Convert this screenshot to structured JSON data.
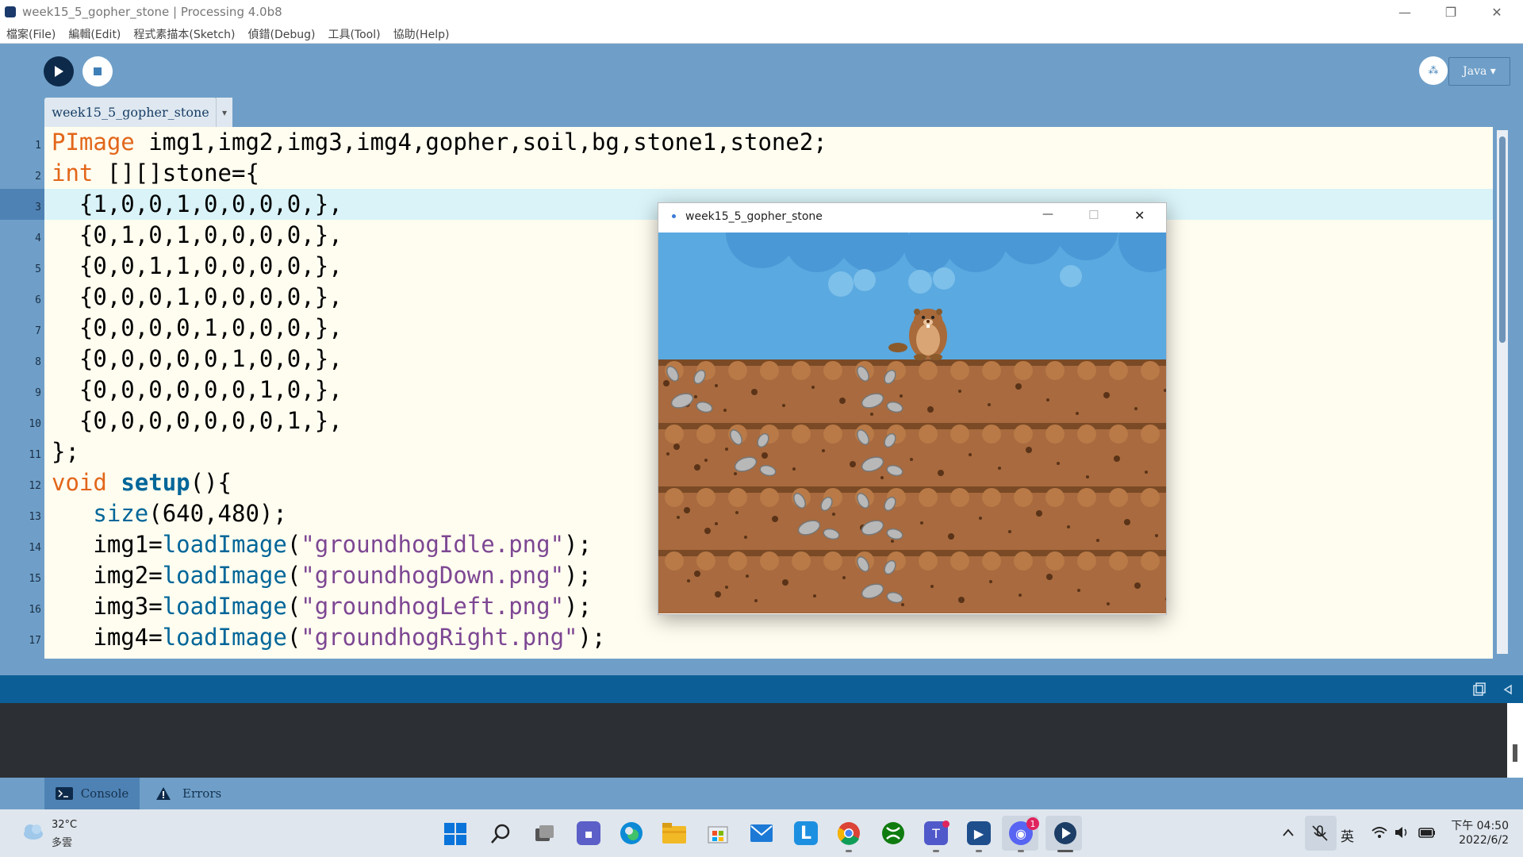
{
  "window": {
    "title": "week15_5_gopher_stone | Processing 4.0b8",
    "min": "—",
    "max": "❐",
    "close": "✕"
  },
  "menu": [
    "檔案(File)",
    "編輯(Edit)",
    "程式素描本(Sketch)",
    "偵錯(Debug)",
    "工具(Tool)",
    "協助(Help)"
  ],
  "toolbar": {
    "mode_icon": "⁂",
    "mode_label": "Java ▾"
  },
  "tab": {
    "label": "week15_5_gopher_stone",
    "arrow": "▾"
  },
  "code_lines": [
    {
      "n": "1",
      "parts": [
        {
          "t": "PImage",
          "c": "kw"
        },
        {
          "t": " img1,img2,img3,img4,gopher,soil,bg,stone1,stone2;",
          "c": ""
        }
      ]
    },
    {
      "n": "2",
      "parts": [
        {
          "t": "int",
          "c": "kw"
        },
        {
          "t": " [][]stone={",
          "c": ""
        }
      ]
    },
    {
      "n": "3",
      "parts": [
        {
          "t": "  {1,0,0,1,0,0,0,0,},",
          "c": ""
        }
      ]
    },
    {
      "n": "4",
      "parts": [
        {
          "t": "  {0,1,0,1,0,0,0,0,},",
          "c": ""
        }
      ]
    },
    {
      "n": "5",
      "parts": [
        {
          "t": "  {0,0,1,1,0,0,0,0,},",
          "c": ""
        }
      ]
    },
    {
      "n": "6",
      "parts": [
        {
          "t": "  {0,0,0,1,0,0,0,0,},",
          "c": ""
        }
      ]
    },
    {
      "n": "7",
      "parts": [
        {
          "t": "  {0,0,0,0,1,0,0,0,},",
          "c": ""
        }
      ]
    },
    {
      "n": "8",
      "parts": [
        {
          "t": "  {0,0,0,0,0,1,0,0,},",
          "c": ""
        }
      ]
    },
    {
      "n": "9",
      "parts": [
        {
          "t": "  {0,0,0,0,0,0,1,0,},",
          "c": ""
        }
      ]
    },
    {
      "n": "10",
      "parts": [
        {
          "t": "  {0,0,0,0,0,0,0,1,},",
          "c": ""
        }
      ]
    },
    {
      "n": "11",
      "parts": [
        {
          "t": "};",
          "c": ""
        }
      ]
    },
    {
      "n": "12",
      "parts": [
        {
          "t": "void",
          "c": "kw"
        },
        {
          "t": " ",
          "c": ""
        },
        {
          "t": "setup",
          "c": "fnb"
        },
        {
          "t": "(){",
          "c": ""
        }
      ]
    },
    {
      "n": "13",
      "parts": [
        {
          "t": "   ",
          "c": ""
        },
        {
          "t": "size",
          "c": "fn"
        },
        {
          "t": "(640,480);",
          "c": ""
        }
      ]
    },
    {
      "n": "14",
      "parts": [
        {
          "t": "   img1=",
          "c": ""
        },
        {
          "t": "loadImage",
          "c": "fn"
        },
        {
          "t": "(",
          "c": ""
        },
        {
          "t": "\"groundhogIdle.png\"",
          "c": "str"
        },
        {
          "t": ");",
          "c": ""
        }
      ]
    },
    {
      "n": "15",
      "parts": [
        {
          "t": "   img2=",
          "c": ""
        },
        {
          "t": "loadImage",
          "c": "fn"
        },
        {
          "t": "(",
          "c": ""
        },
        {
          "t": "\"groundhogDown.png\"",
          "c": "str"
        },
        {
          "t": ");",
          "c": ""
        }
      ]
    },
    {
      "n": "16",
      "parts": [
        {
          "t": "   img3=",
          "c": ""
        },
        {
          "t": "loadImage",
          "c": "fn"
        },
        {
          "t": "(",
          "c": ""
        },
        {
          "t": "\"groundhogLeft.png\"",
          "c": "str"
        },
        {
          "t": ");",
          "c": ""
        }
      ]
    },
    {
      "n": "17",
      "parts": [
        {
          "t": "   img4=",
          "c": ""
        },
        {
          "t": "loadImage",
          "c": "fn"
        },
        {
          "t": "(",
          "c": ""
        },
        {
          "t": "\"groundhogRight.png\"",
          "c": "str"
        },
        {
          "t": ");",
          "c": ""
        }
      ]
    }
  ],
  "sketch_window": {
    "title": "week15_5_gopher_stone",
    "min": "—",
    "max": "☐",
    "close": "✕"
  },
  "stone_grid": [
    [
      1,
      0,
      0,
      1,
      0,
      0,
      0,
      0
    ],
    [
      0,
      1,
      0,
      1,
      0,
      0,
      0,
      0
    ],
    [
      0,
      0,
      1,
      1,
      0,
      0,
      0,
      0
    ],
    [
      0,
      0,
      0,
      1,
      0,
      0,
      0,
      0
    ]
  ],
  "bottom_tabs": {
    "console": "Console",
    "errors": "Errors"
  },
  "taskbar": {
    "weather_temp": "32°C",
    "weather_desc": "多雲",
    "ime": "英",
    "time": "下午 04:50",
    "date": "2022/6/2",
    "discord_badge": "1"
  },
  "colors": {
    "accent": "#6f9fc8",
    "status": "#0b5f96",
    "keyword": "#e2661a",
    "function": "#006699",
    "string": "#7d4793"
  }
}
